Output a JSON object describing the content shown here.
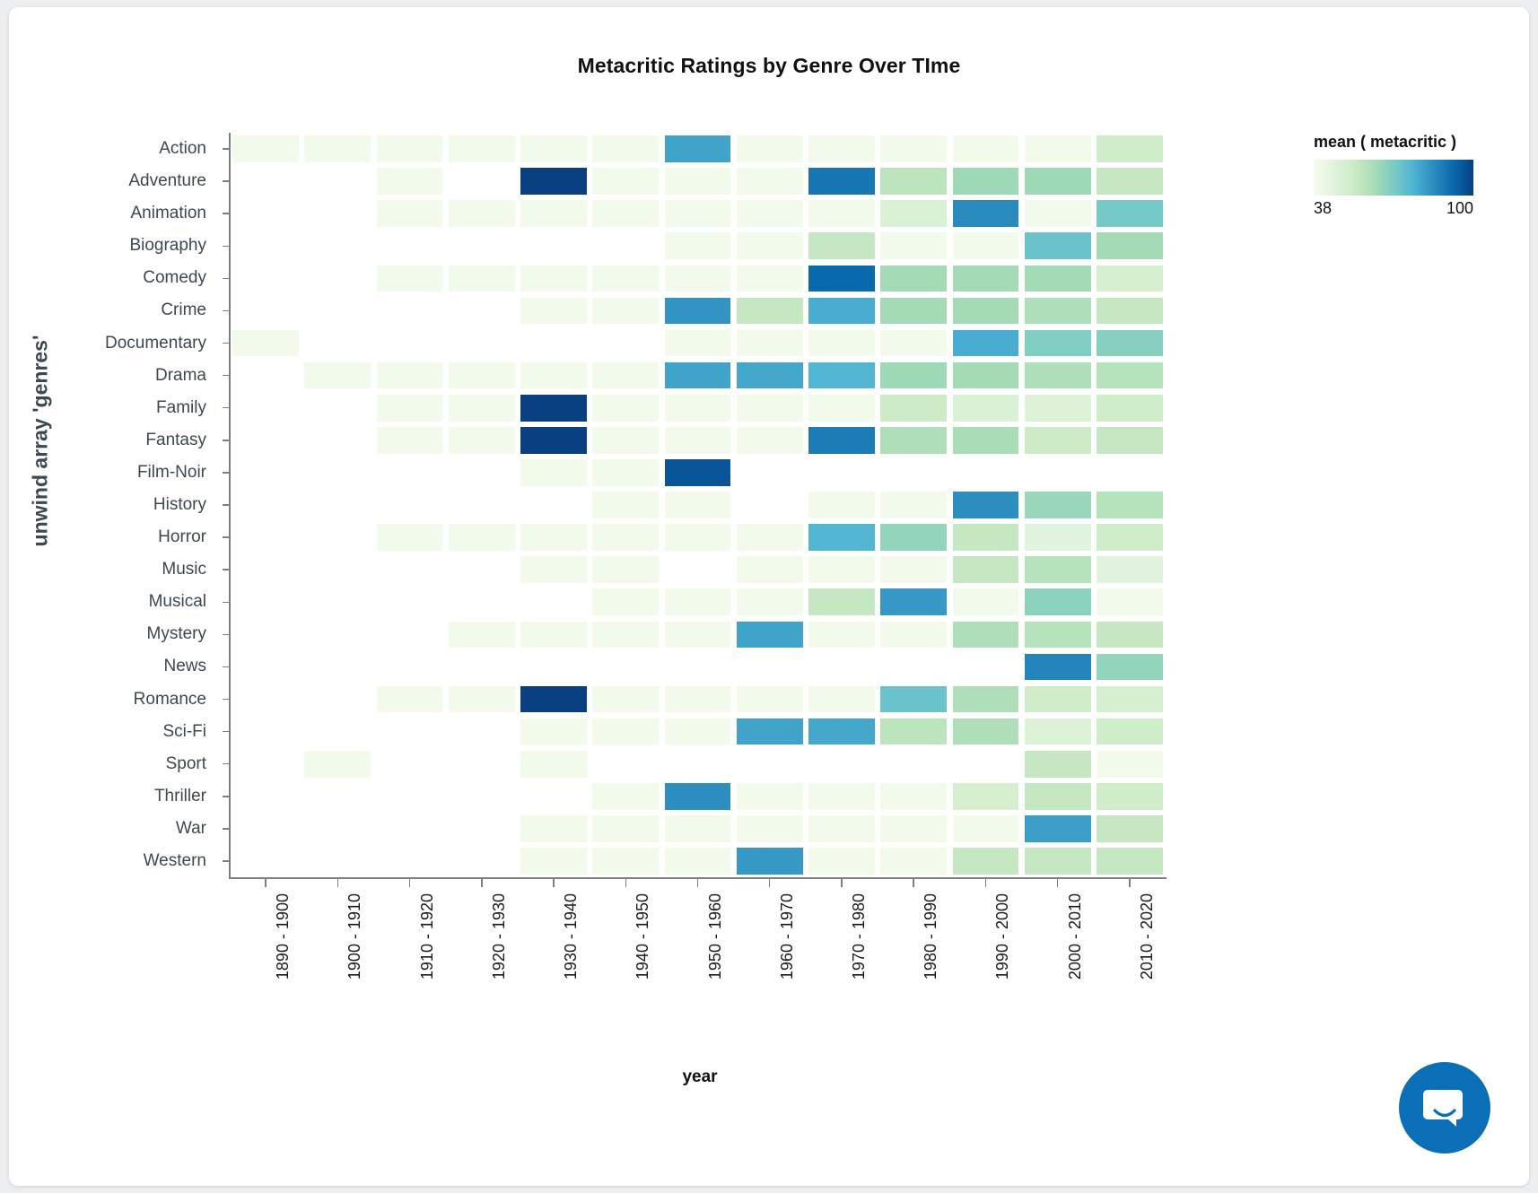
{
  "page": {
    "background": "#eceef0",
    "card_background": "#ffffff"
  },
  "header": {
    "title": "Metacritic Ratings by Genre Over TIme"
  },
  "legend": {
    "title": "mean ( metacritic )",
    "min_label": "38",
    "max_label": "100",
    "gradient_from": "#f7fcf0",
    "gradient_mid": "#7bccc4",
    "gradient_to": "#084081",
    "scheme": "GnBu"
  },
  "axes": {
    "x_title": "year",
    "y_title": "unwind array 'genres'"
  },
  "chat": {
    "icon": "chat-bubble-icon",
    "color": "#0b6fb8"
  },
  "chart_data": {
    "type": "heatmap",
    "title": "Metacritic Ratings by Genre Over TIme",
    "xlabel": "year",
    "ylabel": "unwind array 'genres'",
    "value_label": "mean ( metacritic )",
    "color_scale": "GnBu",
    "zlim": [
      38,
      100
    ],
    "grid": false,
    "legend_position": "right",
    "x_categories": [
      "1890 - 1900",
      "1900 - 1910",
      "1910 - 1920",
      "1920 - 1930",
      "1930 - 1940",
      "1940 - 1950",
      "1950 - 1960",
      "1960 - 1970",
      "1970 - 1980",
      "1980 - 1990",
      "1990 - 2000",
      "2000 - 2010",
      "2010 - 2020"
    ],
    "y_categories": [
      "Action",
      "Adventure",
      "Animation",
      "Biography",
      "Comedy",
      "Crime",
      "Documentary",
      "Drama",
      "Family",
      "Fantasy",
      "Film-Noir",
      "History",
      "Horror",
      "Music",
      "Musical",
      "Mystery",
      "News",
      "Romance",
      "Sci-Fi",
      "Sport",
      "Thriller",
      "War",
      "Western"
    ],
    "values": [
      [
        40,
        40,
        40,
        40,
        40,
        40,
        80,
        40,
        40,
        40,
        40,
        40,
        52
      ],
      [
        null,
        null,
        40,
        null,
        100,
        40,
        40,
        40,
        89,
        57,
        63,
        63,
        55
      ],
      [
        null,
        null,
        40,
        40,
        40,
        40,
        40,
        40,
        40,
        48,
        85,
        40,
        70
      ],
      [
        null,
        null,
        null,
        null,
        null,
        null,
        40,
        40,
        55,
        40,
        40,
        72,
        62
      ],
      [
        null,
        null,
        40,
        40,
        40,
        40,
        40,
        40,
        92,
        62,
        62,
        62,
        50
      ],
      [
        null,
        null,
        null,
        null,
        40,
        40,
        83,
        55,
        78,
        62,
        62,
        60,
        55
      ],
      [
        40,
        null,
        null,
        null,
        null,
        null,
        40,
        40,
        40,
        40,
        78,
        68,
        67
      ],
      [
        null,
        40,
        40,
        40,
        40,
        40,
        80,
        79,
        76,
        63,
        62,
        60,
        58
      ],
      [
        null,
        null,
        40,
        40,
        100,
        40,
        40,
        40,
        40,
        53,
        48,
        47,
        52
      ],
      [
        null,
        null,
        40,
        40,
        100,
        40,
        40,
        40,
        88,
        60,
        61,
        53,
        55
      ],
      [
        null,
        null,
        null,
        null,
        40,
        40,
        96,
        null,
        null,
        null,
        null,
        null,
        null
      ],
      [
        null,
        null,
        null,
        null,
        null,
        40,
        40,
        null,
        40,
        40,
        84,
        64,
        58
      ],
      [
        null,
        null,
        40,
        40,
        40,
        40,
        40,
        40,
        76,
        65,
        55,
        45,
        52
      ],
      [
        null,
        null,
        null,
        null,
        40,
        40,
        null,
        40,
        40,
        40,
        55,
        58,
        45
      ],
      [
        null,
        null,
        null,
        null,
        null,
        40,
        40,
        40,
        55,
        82,
        40,
        66,
        40
      ],
      [
        null,
        null,
        null,
        40,
        40,
        40,
        40,
        80,
        40,
        40,
        60,
        58,
        55
      ],
      [
        null,
        null,
        null,
        null,
        null,
        null,
        null,
        null,
        null,
        null,
        null,
        86,
        65
      ],
      [
        null,
        null,
        40,
        40,
        100,
        40,
        40,
        40,
        40,
        72,
        60,
        52,
        50
      ],
      [
        null,
        null,
        null,
        null,
        40,
        40,
        40,
        80,
        79,
        57,
        60,
        47,
        52
      ],
      [
        null,
        40,
        null,
        null,
        40,
        null,
        null,
        null,
        null,
        null,
        null,
        55,
        40
      ],
      [
        null,
        null,
        null,
        null,
        null,
        40,
        84,
        40,
        40,
        40,
        50,
        55,
        52
      ],
      [
        null,
        null,
        null,
        null,
        40,
        40,
        40,
        40,
        40,
        40,
        40,
        81,
        55
      ],
      [
        null,
        null,
        null,
        null,
        40,
        40,
        40,
        82,
        40,
        40,
        55,
        55,
        55
      ]
    ]
  }
}
